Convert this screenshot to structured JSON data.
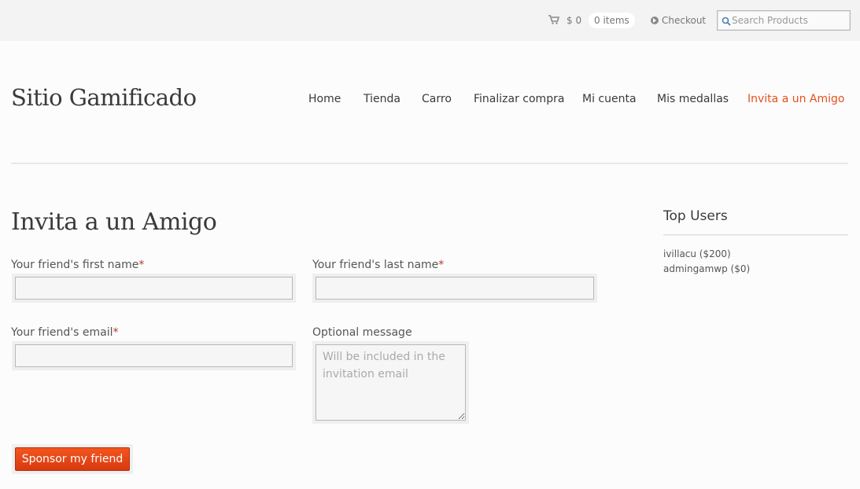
{
  "topbar": {
    "cart_amount": "$ 0",
    "items_count": "0 items",
    "checkout_label": "Checkout",
    "search_placeholder": "Search Products"
  },
  "site": {
    "title": "Sitio Gamificado"
  },
  "nav": {
    "items": [
      {
        "label": "Home"
      },
      {
        "label": "Tienda"
      },
      {
        "label": "Carro"
      },
      {
        "label": "Finalizar compra"
      },
      {
        "label": "Mi cuenta"
      },
      {
        "label": "Mis medallas"
      },
      {
        "label": "Invita a un Amigo",
        "active": true
      }
    ]
  },
  "main": {
    "title": "Invita a un Amigo",
    "form": {
      "first_name_label": "Your friend's first name",
      "last_name_label": "Your friend's last name",
      "email_label": "Your friend's email",
      "message_label": "Optional message",
      "required_marker": "*",
      "message_placeholder": "Will be included in the invitation email",
      "first_name_value": "",
      "last_name_value": "",
      "email_value": "",
      "submit_label": "Sponsor my friend"
    }
  },
  "sidebar": {
    "widget_title": "Top Users",
    "users": [
      {
        "text": "ivillacu ($200)"
      },
      {
        "text": "admingamwp ($0)"
      }
    ]
  },
  "colors": {
    "accent": "#e6511c",
    "button": "#e0461a",
    "required": "#b23a32",
    "text": "#3a3a3a"
  }
}
